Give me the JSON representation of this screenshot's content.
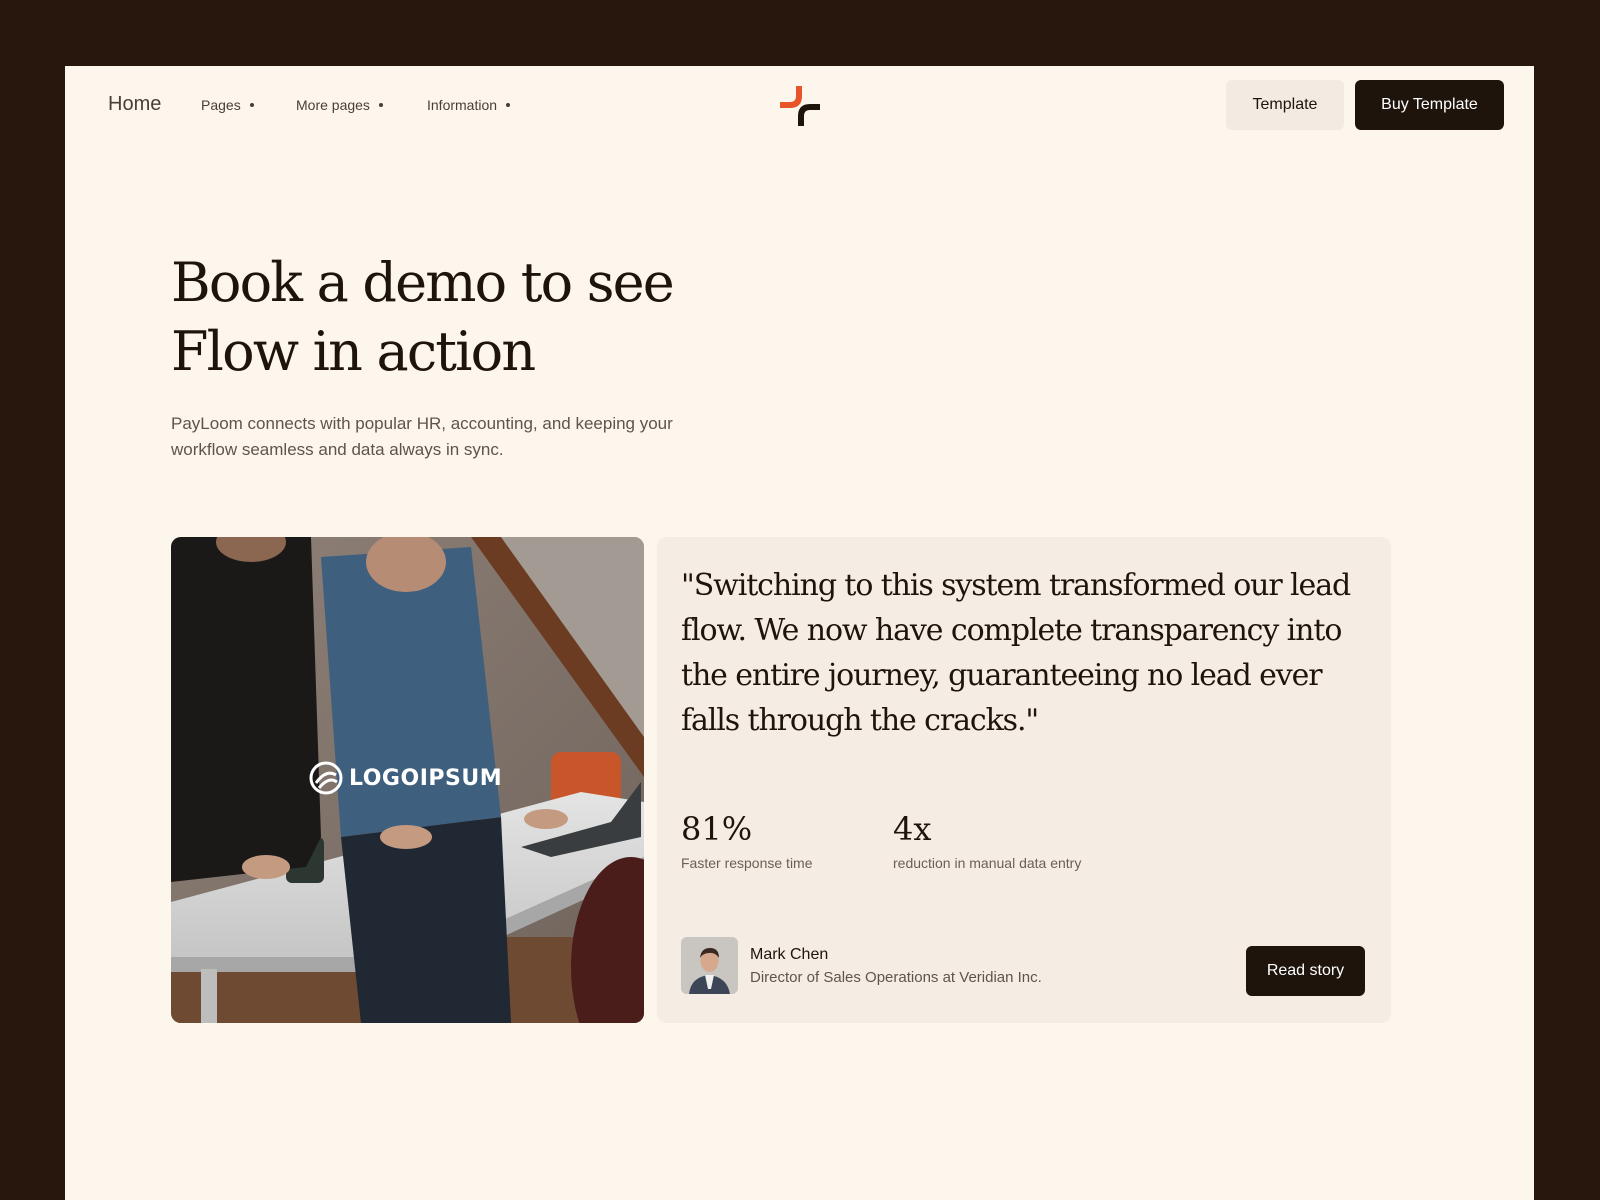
{
  "nav": {
    "home": "Home",
    "links": [
      {
        "label": "Pages"
      },
      {
        "label": "More pages"
      },
      {
        "label": "Information"
      }
    ],
    "logo_icon": "flow-cross-logo-icon",
    "template_button": "Template",
    "buy_button": "Buy Template"
  },
  "hero": {
    "title_line1": "Book a demo to see",
    "title_line2": "Flow in action",
    "subtitle": "PayLoom connects with popular HR, accounting, and keeping your workflow seamless and data always in sync."
  },
  "case_study": {
    "image": "office-meeting-photo",
    "logo_text": "LOGOIPSUM",
    "quote": "\"Switching to this system transformed our lead flow. We now have complete transparency into the entire journey, guaranteeing no lead ever falls through the cracks.\"",
    "stats": [
      {
        "value": "81%",
        "label": "Faster response time"
      },
      {
        "value": "4x",
        "label": "reduction in manual data entry"
      }
    ],
    "author": {
      "name": "Mark Chen",
      "role": "Director of Sales Operations at Veridian Inc."
    },
    "read_button": "Read story"
  },
  "colors": {
    "frame_bg": "#27170c",
    "page_bg": "#fdf6ec",
    "card_bg": "#f5ede3",
    "dark": "#1e140c",
    "accent": "#e8542a"
  }
}
